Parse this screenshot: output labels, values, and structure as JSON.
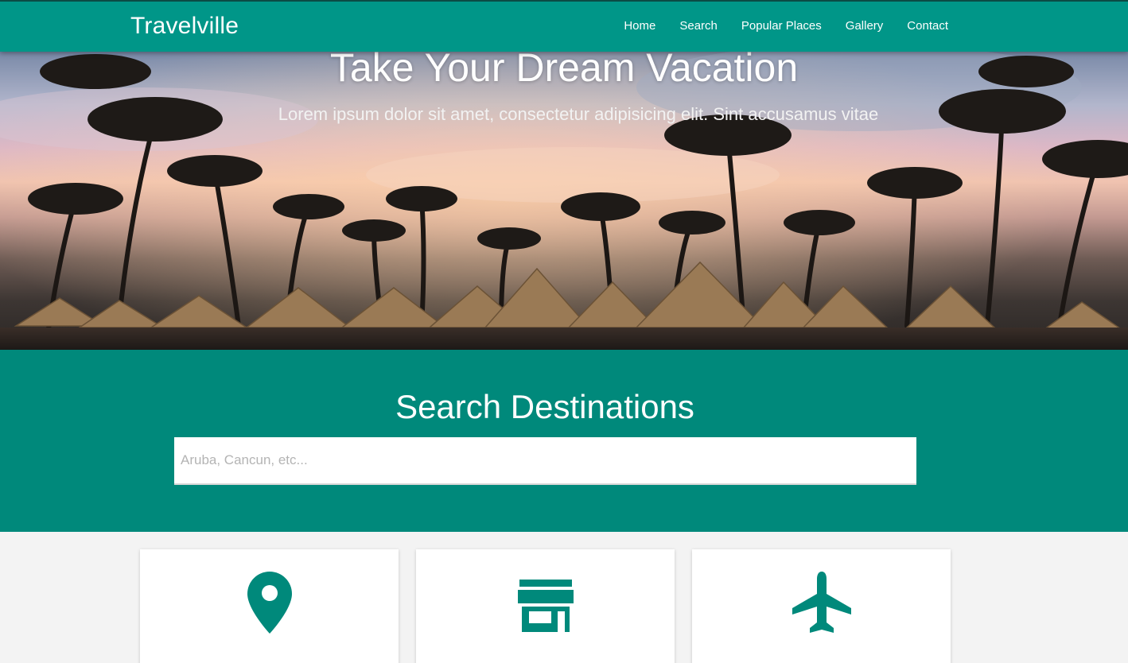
{
  "navbar": {
    "brand": "Travelville",
    "links": [
      "Home",
      "Search",
      "Popular Places",
      "Gallery",
      "Contact"
    ]
  },
  "hero": {
    "title": "Take Your Dream Vacation",
    "subtitle": "Lorem ipsum dolor sit amet, consectetur adipisicing elit. Sint accusamus vitae"
  },
  "search": {
    "title": "Search Destinations",
    "placeholder": "Aruba, Cancun, etc..."
  },
  "cards": [
    {
      "icon": "map-marker-icon"
    },
    {
      "icon": "store-icon"
    },
    {
      "icon": "airplane-icon"
    }
  ],
  "colors": {
    "primary": "#009688",
    "search_bg": "#00897b",
    "page_bg": "#f3f3f3"
  }
}
